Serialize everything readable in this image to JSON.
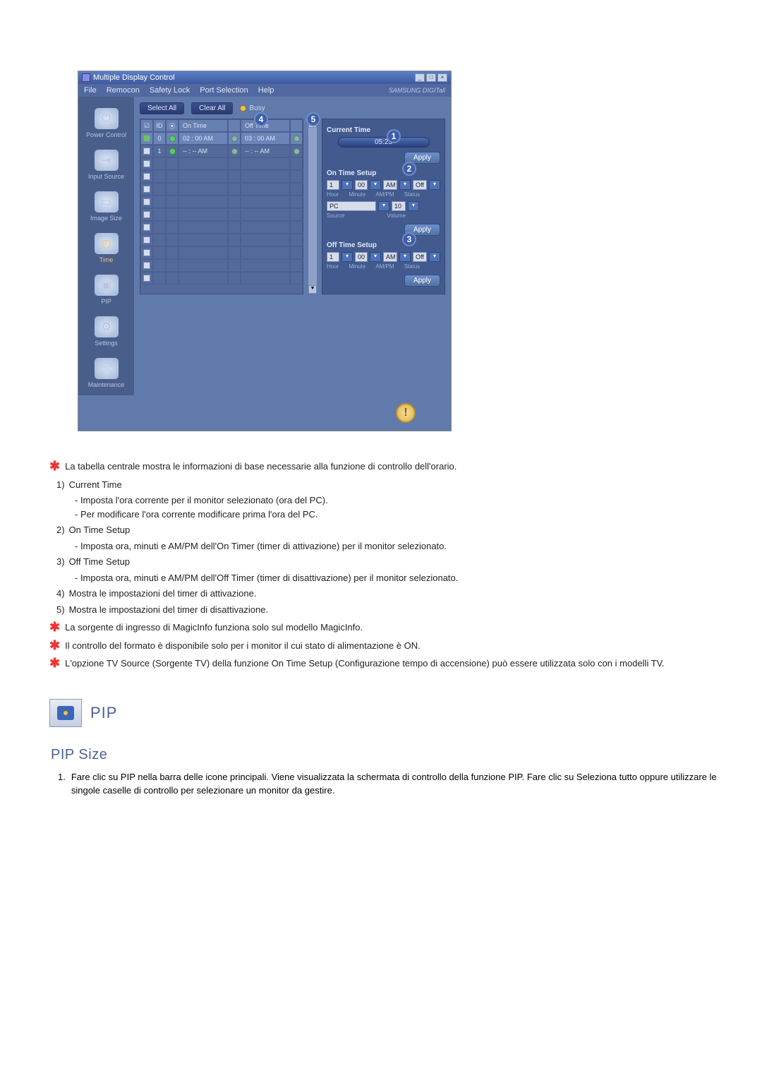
{
  "window": {
    "title": "Multiple Display Control",
    "menu": [
      "File",
      "Remocon",
      "Safety Lock",
      "Port Selection",
      "Help"
    ],
    "brand": "SAMSUNG DIGITall"
  },
  "sidebar": {
    "items": [
      {
        "label": "Power Control"
      },
      {
        "label": "Input Source"
      },
      {
        "label": "Image Size"
      },
      {
        "label": "Time"
      },
      {
        "label": "PIP"
      },
      {
        "label": "Settings"
      },
      {
        "label": "Maintenance"
      }
    ]
  },
  "buttons": {
    "select_all": "Select All",
    "clear_all": "Clear All",
    "busy": "Busy",
    "apply": "Apply"
  },
  "grid": {
    "headers": {
      "chk": "☑",
      "id": "ID",
      "st": "⦿",
      "on_time": "On Time",
      "off_time": "Off Time"
    },
    "row": {
      "id": "0",
      "on_time": "02 : 00 AM",
      "off_time": "03 : 00 AM"
    },
    "empty_row": {
      "id": "1",
      "on_time": "-- : -- AM",
      "off_time": "-- : -- AM"
    }
  },
  "panel": {
    "current_time_label": "Current Time",
    "current_time_value": "05:23",
    "on_time_label": "On Time Setup",
    "off_time_label": "Off Time Setup",
    "hour": "1",
    "minute": "00",
    "ampm": "AM",
    "status": "Off",
    "source": "PC",
    "volume": "10",
    "sublabels": {
      "hour": "Hour",
      "minute": "Minute",
      "ampm": "AM/PM",
      "status": "Status",
      "source": "Source",
      "volume": "Volume"
    }
  },
  "markers": {
    "m1": "1",
    "m2": "2",
    "m3": "3",
    "m4": "4",
    "m5": "5"
  },
  "notes": {
    "intro": "La tabella centrale mostra le informazioni di base necessarie alla funzione di controllo dell'orario.",
    "n1_title": "Current Time",
    "n1_a": "- Imposta l'ora corrente per il monitor selezionato (ora del PC).",
    "n1_b": "- Per modificare l'ora corrente modificare prima l'ora del PC.",
    "n2_title": "On Time Setup",
    "n2_a": "- Imposta ora, minuti e AM/PM dell'On Timer (timer di attivazione) per il monitor selezionato.",
    "n3_title": "Off Time Setup",
    "n3_a": "- Imposta ora, minuti e AM/PM dell'Off Timer (timer di disattivazione) per il monitor selezionato.",
    "n4": "Mostra le impostazioni del timer di attivazione.",
    "n5": "Mostra le impostazioni del timer di disattivazione.",
    "star1": "La sorgente di ingresso di MagicInfo funziona solo sul modello MagicInfo.",
    "star2": "Il controllo del formato è disponibile solo per i monitor il cui stato di alimentazione è ON.",
    "star3": "L'opzione TV Source (Sorgente TV) della funzione On Time Setup (Configurazione tempo di accensione) può essere utilizzata solo con i modelli TV."
  },
  "pip": {
    "title": "PIP",
    "subtitle": "PIP Size",
    "step1": "Fare clic su PIP nella barra delle icone principali. Viene visualizzata la schermata di controllo della funzione PIP. Fare clic su Seleziona tutto oppure utilizzare le singole caselle di controllo per selezionare un monitor da gestire."
  }
}
